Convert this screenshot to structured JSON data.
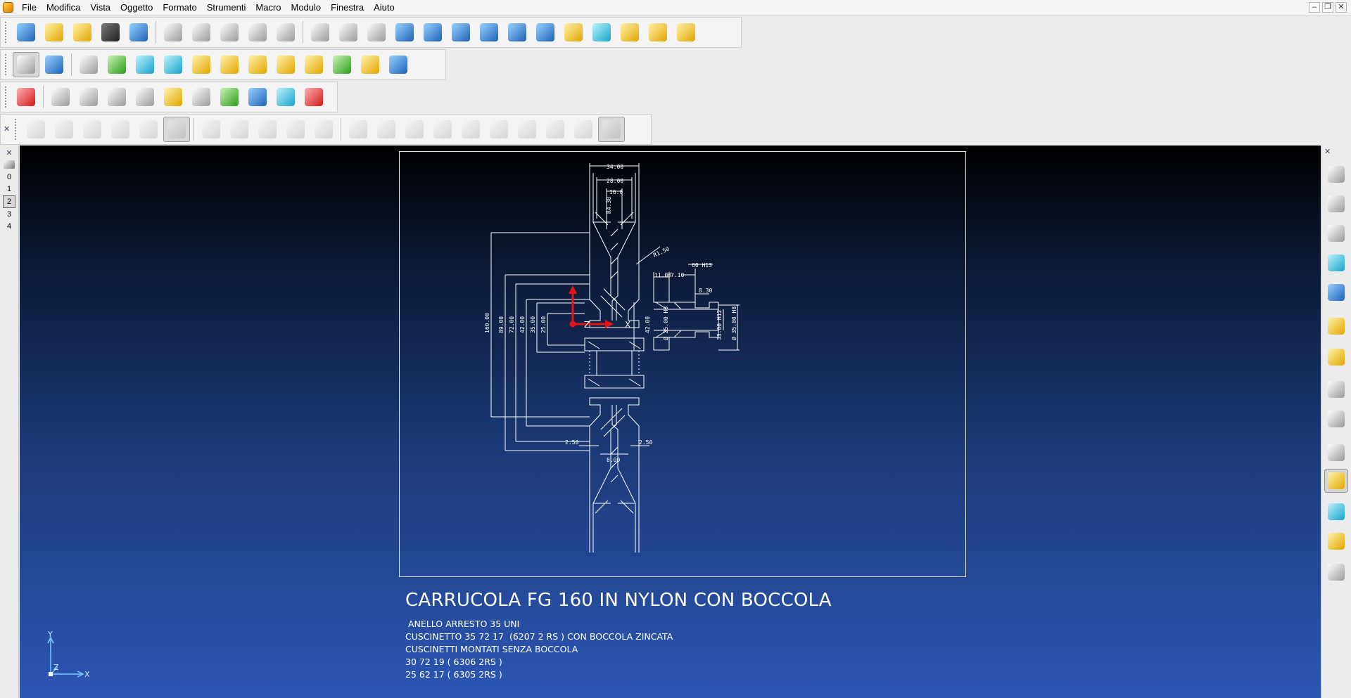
{
  "menu": {
    "items": [
      "File",
      "Modifica",
      "Vista",
      "Oggetto",
      "Formato",
      "Strumenti",
      "Macro",
      "Modulo",
      "Finestra",
      "Aiuto"
    ]
  },
  "window_controls": {
    "minimize": "–",
    "restore": "❐",
    "close": "✕"
  },
  "toolbars": {
    "standard": [
      {
        "name": "new-file-icon",
        "color": "blue"
      },
      {
        "name": "open-folder-icon",
        "color": "yellow"
      },
      {
        "name": "import-icon",
        "color": "yellow"
      },
      {
        "name": "save-icon",
        "color": "dark"
      },
      {
        "name": "print-icon",
        "color": "blue"
      },
      {
        "name": "cut-icon",
        "color": "gray"
      },
      {
        "name": "copy-icon",
        "color": "gray"
      },
      {
        "name": "paste-icon",
        "color": "gray"
      },
      {
        "name": "format-painter-icon",
        "color": "gray"
      },
      {
        "name": "delete-icon",
        "color": "gray"
      },
      {
        "name": "undo-icon",
        "color": "gray"
      },
      {
        "name": "redo-icon",
        "color": "gray"
      },
      {
        "name": "sketch-pen-icon",
        "color": "gray"
      },
      {
        "name": "layers-icon",
        "color": "blue"
      },
      {
        "name": "coordinate-system-icon",
        "color": "blue"
      },
      {
        "name": "polyline-icon",
        "color": "blue"
      },
      {
        "name": "circle-icon",
        "color": "blue"
      },
      {
        "name": "spline-icon",
        "color": "blue"
      },
      {
        "name": "text-icon",
        "color": "blue"
      },
      {
        "name": "surface-icon",
        "color": "yellow"
      },
      {
        "name": "box-icon",
        "color": "cyan"
      },
      {
        "name": "stacked-plates-icon",
        "color": "yellow"
      },
      {
        "name": "gears-icon",
        "color": "yellow"
      },
      {
        "name": "magic-wand-icon",
        "color": "yellow"
      }
    ],
    "modeling": [
      {
        "name": "select-pointer-icon",
        "color": "gray",
        "active": true
      },
      {
        "name": "transform-icon",
        "color": "blue"
      },
      {
        "name": "curve-icon",
        "color": "gray"
      },
      {
        "name": "intersection-icon",
        "color": "green"
      },
      {
        "name": "extrude-icon",
        "color": "cyan"
      },
      {
        "name": "revolve-icon",
        "color": "cyan"
      },
      {
        "name": "boolean-union-icon",
        "color": "yellow"
      },
      {
        "name": "boolean-subtract-icon",
        "color": "yellow"
      },
      {
        "name": "solid-box-icon",
        "color": "yellow"
      },
      {
        "name": "pattern-array-icon",
        "color": "yellow"
      },
      {
        "name": "surface-from-curves-icon",
        "color": "yellow"
      },
      {
        "name": "normals-icon",
        "color": "green"
      },
      {
        "name": "shaded-sphere-icon",
        "color": "yellow"
      },
      {
        "name": "pyramid-icon",
        "color": "blue"
      }
    ],
    "analysis": [
      {
        "name": "warning-icon",
        "color": "red"
      },
      {
        "name": "bend-icon",
        "color": "gray"
      },
      {
        "name": "grid-icon",
        "color": "gray"
      },
      {
        "name": "joint-icon",
        "color": "gray"
      },
      {
        "name": "twist-icon",
        "color": "gray"
      },
      {
        "name": "inspect-icon",
        "color": "yellow"
      },
      {
        "name": "gear-sheet-icon",
        "color": "gray"
      },
      {
        "name": "sync-icon",
        "color": "green"
      },
      {
        "name": "measure-magnifier-icon",
        "color": "blue"
      },
      {
        "name": "view-box-icon",
        "color": "cyan"
      },
      {
        "name": "add-red-cross-icon",
        "color": "red"
      }
    ],
    "sheetmetal": [
      {
        "name": "sheet-flange-icon",
        "color": "gray"
      },
      {
        "name": "sheet-bend-icon",
        "color": "gray"
      },
      {
        "name": "sheet-unfold-icon",
        "color": "gray"
      },
      {
        "name": "sheet-fold-icon",
        "color": "gray"
      },
      {
        "name": "sheet-corner-icon",
        "color": "gray"
      },
      {
        "name": "sheet-surface-icon",
        "color": "gray",
        "active": true
      },
      {
        "name": "sheet-wave-icon",
        "color": "gray"
      },
      {
        "name": "sheet-hook-icon",
        "color": "gray"
      },
      {
        "name": "sheet-number-icon",
        "color": "gray"
      },
      {
        "name": "sheet-roll-icon",
        "color": "gray"
      },
      {
        "name": "sheet-stack-icon",
        "color": "gray"
      },
      {
        "name": "sheet-rip-icon",
        "color": "gray"
      },
      {
        "name": "sheet-lance-icon",
        "color": "gray"
      },
      {
        "name": "sheet-spring-icon",
        "color": "gray"
      },
      {
        "name": "sheet-helix-icon",
        "color": "gray"
      },
      {
        "name": "sheet-coil-icon",
        "color": "gray"
      },
      {
        "name": "sheet-star-icon",
        "color": "gray"
      },
      {
        "name": "sheet-tee-icon",
        "color": "gray"
      },
      {
        "name": "sheet-zigzag-icon",
        "color": "gray"
      },
      {
        "name": "sheet-arrow-icon",
        "color": "gray"
      },
      {
        "name": "sheet-arc-icon",
        "color": "gray",
        "active": true
      }
    ]
  },
  "left_strip": {
    "close": "✕",
    "layers": [
      "0",
      "1",
      "2",
      "3",
      "4"
    ],
    "selected_layer": "2"
  },
  "right_panel": {
    "close": "✕",
    "buttons": [
      {
        "name": "view-iso-wire-icon",
        "color": "gray"
      },
      {
        "name": "view-iso-hidden-icon",
        "color": "gray"
      },
      {
        "name": "view-iso-front-icon",
        "color": "gray"
      },
      {
        "name": "view-cube-shaded-icon",
        "color": "cyan"
      },
      {
        "name": "camera-icon",
        "color": "blue"
      },
      {
        "name": "undo-view-icon",
        "color": "yellow"
      },
      {
        "name": "zoom-rotate-icon",
        "color": "yellow"
      },
      {
        "name": "zoom-extents-icon",
        "color": "gray"
      },
      {
        "name": "zoom-window-icon",
        "color": "gray"
      },
      {
        "name": "wireframe-sphere-icon",
        "color": "gray"
      },
      {
        "name": "shaded-sphere-icon",
        "color": "yellow",
        "active": true
      },
      {
        "name": "plane-view-icon",
        "color": "cyan"
      },
      {
        "name": "render-sphere-icon",
        "color": "yellow"
      },
      {
        "name": "lights-icon",
        "color": "gray"
      }
    ]
  },
  "drawing": {
    "title": "CARRUCOLA FG 160 IN NYLON CON BOCCOLA",
    "notes": [
      " ANELLO ARRESTO 35 UNI",
      "CUSCINETTO 35 72 17  (6207 2 RS ) CON BOCCOLA ZINCATA",
      "CUSCINETTI MONTATI SENZA BOCCOLA",
      "30 72 19 ( 6306 2RS )",
      "25 62 17 ( 6305 2RS )"
    ],
    "dimensions": {
      "top_width_1": "34.00",
      "top_width_2": "28.00",
      "top_width_3": "16.0",
      "groove_depth": "R4.30",
      "radius": "R1.50",
      "diameter_160": "160.00",
      "diameter_89": "89.00",
      "diameter_72": "72.00",
      "diameter_42": "42.00",
      "diameter_35": "35.00",
      "diameter_25": "25.00",
      "flange_left": "2.50",
      "flange_right": "2.50",
      "hub_width": "8.00",
      "bush_len_1": "11.00",
      "bush_len_2": "7.10",
      "bush_tol": "60 H13",
      "bush_groove": "8.30",
      "bush_d42": "42.00",
      "bush_d25": "Ø 25.00 H8",
      "bush_d33": "33.00 H12",
      "bush_d35": "Ø 35.00 H8"
    },
    "axis_labels": {
      "x": "X",
      "z": "Z"
    }
  },
  "triad": {
    "x": "X",
    "y": "Y",
    "z": "Z"
  },
  "colors": {
    "viewport_top": "#000000",
    "viewport_bottom": "#2b56b3",
    "drawing_lines": "#ffffff",
    "axis_red": "#e31414"
  }
}
